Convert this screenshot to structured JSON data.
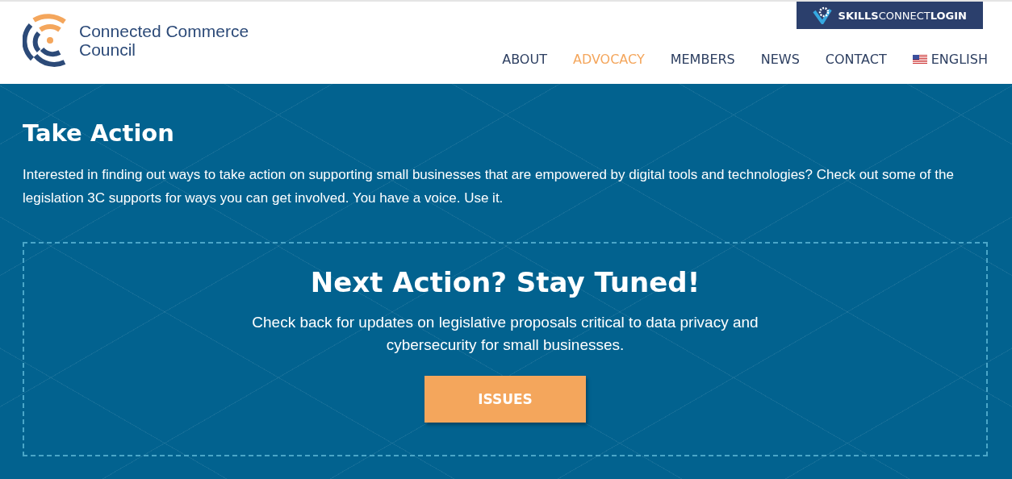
{
  "header": {
    "logo_text": [
      "Connected Commerce",
      "Council"
    ],
    "login_button": "**SKILLS**CONNECT**LOGIN**",
    "nav": [
      {
        "label": "ABOUT",
        "selected": false
      },
      {
        "label": "ADVOCACY",
        "selected": true
      },
      {
        "label": "MEMBERS",
        "selected": false
      },
      {
        "label": "NEWS",
        "selected": false
      },
      {
        "label": "CONTACT",
        "selected": false
      },
      {
        "label": "ENGLISH",
        "selected": false,
        "kind": "language"
      }
    ]
  },
  "intro": {
    "title": "Take Action",
    "text": "Interested in finding out ways to take action on supporting small businesses that are empowered by digital tools and technologies? Check out some of the legislation 3C supports for ways you can get involved. You have a voice. Use it."
  },
  "callout": {
    "title": "Next Action? Stay Tuned!",
    "text": "Check back for updates on legislative proposals critical to data privacy and cybersecurity for small businesses.",
    "button": "ISSUES"
  }
}
